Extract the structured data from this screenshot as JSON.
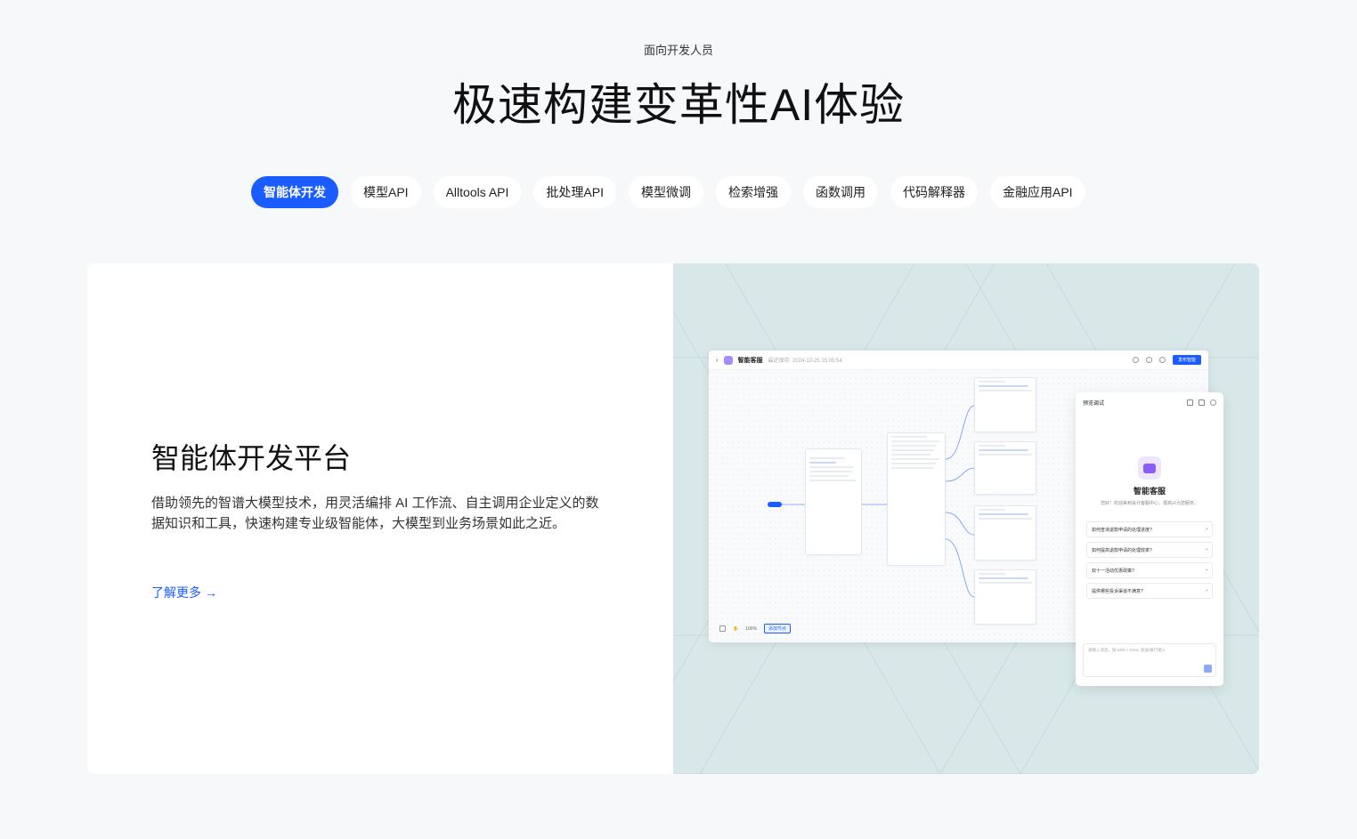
{
  "header": {
    "eyebrow": "面向开发人员",
    "headline": "极速构建变革性AI体验"
  },
  "tabs": [
    {
      "label": "智能体开发",
      "active": true
    },
    {
      "label": "模型API",
      "active": false
    },
    {
      "label": "Alltools API",
      "active": false
    },
    {
      "label": "批处理API",
      "active": false
    },
    {
      "label": "模型微调",
      "active": false
    },
    {
      "label": "检索增强",
      "active": false
    },
    {
      "label": "函数调用",
      "active": false
    },
    {
      "label": "代码解释器",
      "active": false
    },
    {
      "label": "金融应用API",
      "active": false
    }
  ],
  "feature": {
    "title": "智能体开发平台",
    "description": "借助领先的智谱大模型技术，用灵活编排 AI 工作流、自主调用企业定义的数据知识和工具，快速构建专业级智能体，大模型到业务场景如此之近。",
    "learn_more": "了解更多",
    "learn_more_arrow": "→"
  },
  "mock_app": {
    "back": "‹",
    "name": "智能客服",
    "saved": "最近保存: 2024-12-25 15:05:54",
    "publish": "发布智能",
    "zoom": "100%",
    "add_node": "添加节点"
  },
  "preview": {
    "title": "预览调试",
    "bot_name": "智能客服",
    "welcome": "您好！欢迎来到会计客服中心，很高兴为您服务。",
    "suggestions": [
      "如何查询退款申请的处理进度?",
      "如何提高退款申请的处理效率?",
      "双十一活动优惠政策?",
      "提供哪些投诉渠道不满意?"
    ],
    "input_placeholder": "请输入消息，按 Shift + Enter 发送/换行输入"
  },
  "colors": {
    "accent": "#1a5cff",
    "page_bg": "#f7f8fa",
    "panel_bg": "#d8e8e9"
  }
}
